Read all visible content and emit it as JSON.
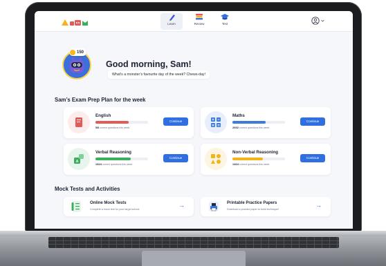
{
  "nav": {
    "tabs": [
      {
        "label": "Learn",
        "icon": "pencil-icon",
        "active": true
      },
      {
        "label": "Review",
        "icon": "books-icon",
        "active": false
      },
      {
        "label": "Test",
        "icon": "graduation-cap-icon",
        "active": false
      }
    ],
    "profile_icon": "user-circle-icon"
  },
  "hero": {
    "coins": "150",
    "greeting": "Good morning, Sam!",
    "joke": "What’s a monster’s favourite day of the week? Chews-day!"
  },
  "plan": {
    "title": "Sam’s Exam Prep Plan for the week",
    "continue_label": "Continue",
    "suffix": "correct questions this week",
    "cards": [
      {
        "subject": "English",
        "score": "5/8",
        "progress": 0.625,
        "color": "#e25b57",
        "tint": "#fdecec"
      },
      {
        "subject": "Maths",
        "score": "20/32",
        "progress": 0.625,
        "color": "#3d7bd9",
        "tint": "#e8eefb"
      },
      {
        "subject": "Verbal Reasoning",
        "score": "16/24",
        "progress": 0.667,
        "color": "#3cae5e",
        "tint": "#e7f5ec"
      },
      {
        "subject": "Non-Verbal Reasoning",
        "score": "14/24",
        "progress": 0.583,
        "color": "#f2b31c",
        "tint": "#fdf4e1"
      }
    ]
  },
  "mock": {
    "title": "Mock Tests and Activities",
    "items": [
      {
        "title": "Online Mock Tests",
        "subtitle": "Complete a mock test for your target school"
      },
      {
        "title": "Printable Practice Papers",
        "subtitle": "Download a practice paper to build technique!"
      }
    ]
  },
  "colors": {
    "accent": "#2f6fe0",
    "text": "#1c2233"
  }
}
